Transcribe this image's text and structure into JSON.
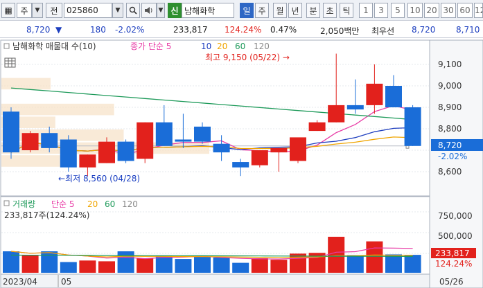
{
  "toolbar": {
    "market": "주",
    "prev_label": "전",
    "code": "025860",
    "credit_badge": "신",
    "stock_name": "남해화학",
    "periods": [
      "일",
      "주",
      "월",
      "년",
      "분",
      "초",
      "틱"
    ],
    "selected_period": "일",
    "numbers": [
      "1",
      "3",
      "5",
      "10",
      "20",
      "30",
      "60",
      "12"
    ]
  },
  "quote": {
    "price": "8,720",
    "change_arrow": "▼",
    "change": "180",
    "change_pct": "-2.02%",
    "volume": "233,817",
    "volume_ratio": "124.24%",
    "turnover": "0.47%",
    "amount": "2,050백만",
    "bid_label": "최우선",
    "bid": "8,720",
    "ask": "8,710"
  },
  "chart": {
    "price_legend": {
      "title": "남해화학 매물대 수(10)",
      "ma_label": "종가 단순 5",
      "ma_periods": [
        "10",
        "20",
        "60",
        "120"
      ]
    },
    "volume_legend": {
      "title": "거래량",
      "ma_label": "단순 5",
      "ma_periods": [
        "20",
        "60",
        "120"
      ],
      "value_text": "233,817주(124.24%)"
    },
    "high_annotation": "최고 9,150 (05/22) →",
    "low_annotation": "←최저 8,560 (04/28)",
    "price_axis": [
      "9,100",
      "9,000",
      "8,900",
      "8,800",
      "8,600"
    ],
    "current_price_tag": "8,720",
    "current_pct_tag": "-2.02%",
    "volume_axis": [
      "750,000",
      "500,000"
    ],
    "current_volume_tag": "233,817",
    "current_volume_pct": "124.24%",
    "x_labels": [
      "2023/04",
      "05",
      "05/26"
    ],
    "colors": {
      "up": "#e2211c",
      "down": "#1a6dd8",
      "ma5": "#e83ca6",
      "ma10": "#1f3fbf",
      "ma20": "#f0a500",
      "ma60": "#1e9a5a",
      "ma120": "#888888"
    }
  },
  "chart_data": {
    "type": "candlestick",
    "y_range": [
      8520,
      9200
    ],
    "volume_range": [
      0,
      850000
    ],
    "candles": [
      {
        "o": 8880,
        "h": 8900,
        "l": 8660,
        "c": 8690
      },
      {
        "o": 8700,
        "h": 8790,
        "l": 8690,
        "c": 8780
      },
      {
        "o": 8780,
        "h": 8810,
        "l": 8690,
        "c": 8710
      },
      {
        "o": 8750,
        "h": 8770,
        "l": 8600,
        "c": 8620
      },
      {
        "o": 8620,
        "h": 8680,
        "l": 8580,
        "c": 8680
      },
      {
        "o": 8640,
        "h": 8760,
        "l": 8640,
        "c": 8740
      },
      {
        "o": 8740,
        "h": 8750,
        "l": 8640,
        "c": 8650
      },
      {
        "o": 8660,
        "h": 8830,
        "l": 8640,
        "c": 8830
      },
      {
        "o": 8830,
        "h": 8910,
        "l": 8720,
        "c": 8720
      },
      {
        "o": 8750,
        "h": 8870,
        "l": 8710,
        "c": 8740
      },
      {
        "o": 8810,
        "h": 8830,
        "l": 8730,
        "c": 8740
      },
      {
        "o": 8730,
        "h": 8770,
        "l": 8650,
        "c": 8690
      },
      {
        "o": 8645,
        "h": 8660,
        "l": 8580,
        "c": 8620
      },
      {
        "o": 8630,
        "h": 8690,
        "l": 8620,
        "c": 8700
      },
      {
        "o": 8690,
        "h": 8710,
        "l": 8600,
        "c": 8710
      },
      {
        "o": 8650,
        "h": 8730,
        "l": 8640,
        "c": 8760
      },
      {
        "o": 8790,
        "h": 8840,
        "l": 8790,
        "c": 8830
      },
      {
        "o": 8830,
        "h": 9150,
        "l": 8830,
        "c": 8910
      },
      {
        "o": 8910,
        "h": 9030,
        "l": 8870,
        "c": 8890
      },
      {
        "o": 8910,
        "h": 9100,
        "l": 8870,
        "c": 9010
      },
      {
        "o": 9000,
        "h": 9050,
        "l": 8900,
        "c": 8900
      },
      {
        "o": 8900,
        "h": 8910,
        "l": 8720,
        "c": 8720
      }
    ],
    "volume": [
      280000,
      230000,
      280000,
      140000,
      160000,
      150000,
      280000,
      190000,
      220000,
      180000,
      210000,
      200000,
      130000,
      190000,
      170000,
      250000,
      260000,
      470000,
      230000,
      410000,
      240000,
      233817
    ]
  }
}
